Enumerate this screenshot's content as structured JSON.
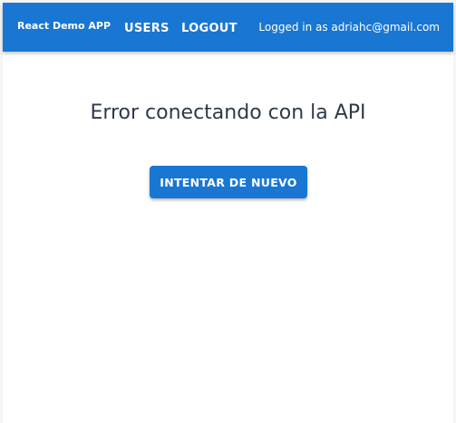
{
  "header": {
    "brand": "React Demo APP",
    "nav": {
      "users_label": "USERS",
      "logout_label": "LOGOUT"
    },
    "logged_in_text": "Logged in as adriahc@gmail.com"
  },
  "main": {
    "error_message": "Error conectando con la API",
    "retry_label": "INTENTAR DE NUEVO"
  },
  "colors": {
    "primary": "#1976d2",
    "title_text": "#2e3a48",
    "background": "#ffffff"
  }
}
